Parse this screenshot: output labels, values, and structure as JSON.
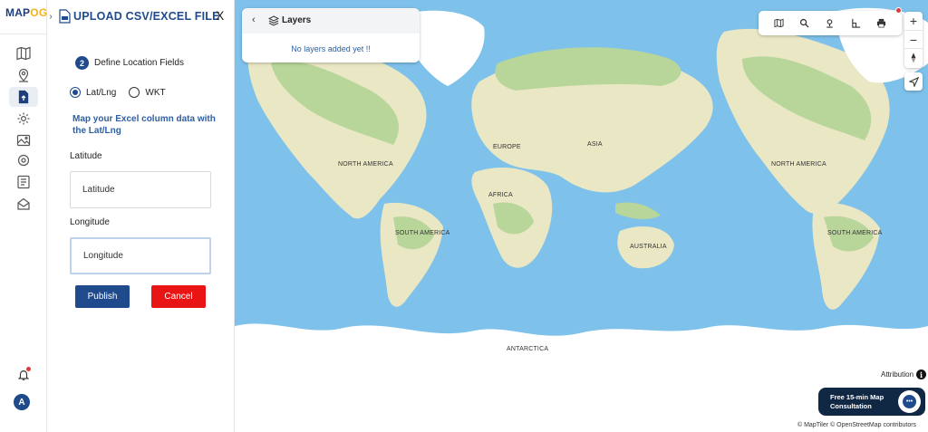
{
  "brand": {
    "logo_main": "MAP",
    "logo_accent": "OG"
  },
  "rail": {
    "icons": [
      "map-icon",
      "pin-icon",
      "upload-file-icon",
      "settings-icon",
      "photo-icon",
      "gear-icon",
      "list-icon",
      "mailbox-icon"
    ],
    "bell_icon": "bell-icon",
    "avatar_letter": "A"
  },
  "panel": {
    "title": "UPLOAD CSV/EXCEL FILE",
    "close_label": "X",
    "step_number": "2",
    "step_label": "Define Location Fields",
    "radio_options": [
      {
        "label": "Lat/Lng",
        "selected": true
      },
      {
        "label": "WKT",
        "selected": false
      }
    ],
    "description": "Map your Excel column data with the Lat/Lng",
    "latitude_label": "Latitude",
    "latitude_placeholder": "Latitude",
    "longitude_label": "Longitude",
    "longitude_placeholder": "Longitude",
    "publish_label": "Publish",
    "cancel_label": "Cancel"
  },
  "layers": {
    "title": "Layers",
    "empty_message": "No layers added yet !!"
  },
  "map": {
    "labels": {
      "europe": "EUROPE",
      "asia": "ASIA",
      "north_america_left": "NORTH AMERICA",
      "north_america_right": "NORTH AMERICA",
      "africa": "AFRICA",
      "south_america_left": "SOUTH AMERICA",
      "south_america_right": "SOUTH AMERICA",
      "australia": "AUSTRALIA",
      "antarctica": "ANTARCTICA"
    },
    "toolbar_icons": [
      "map-layers-icon",
      "search-icon",
      "location-pin-icon",
      "measure-icon",
      "print-icon"
    ],
    "zoom_in": "+",
    "zoom_out": "−",
    "attribution_label": "Attribution",
    "attribution_info": "i",
    "credits": "© MapTiler © OpenStreetMap contributors"
  },
  "consultation": {
    "text": "Free 15-min Map Consultation"
  },
  "colors": {
    "brand_blue": "#1f4a8c",
    "cancel_red": "#e91414",
    "ocean": "#7ec1ea",
    "land": "#e9e7c4",
    "forest": "#b8d59a",
    "ice": "#ffffff"
  }
}
